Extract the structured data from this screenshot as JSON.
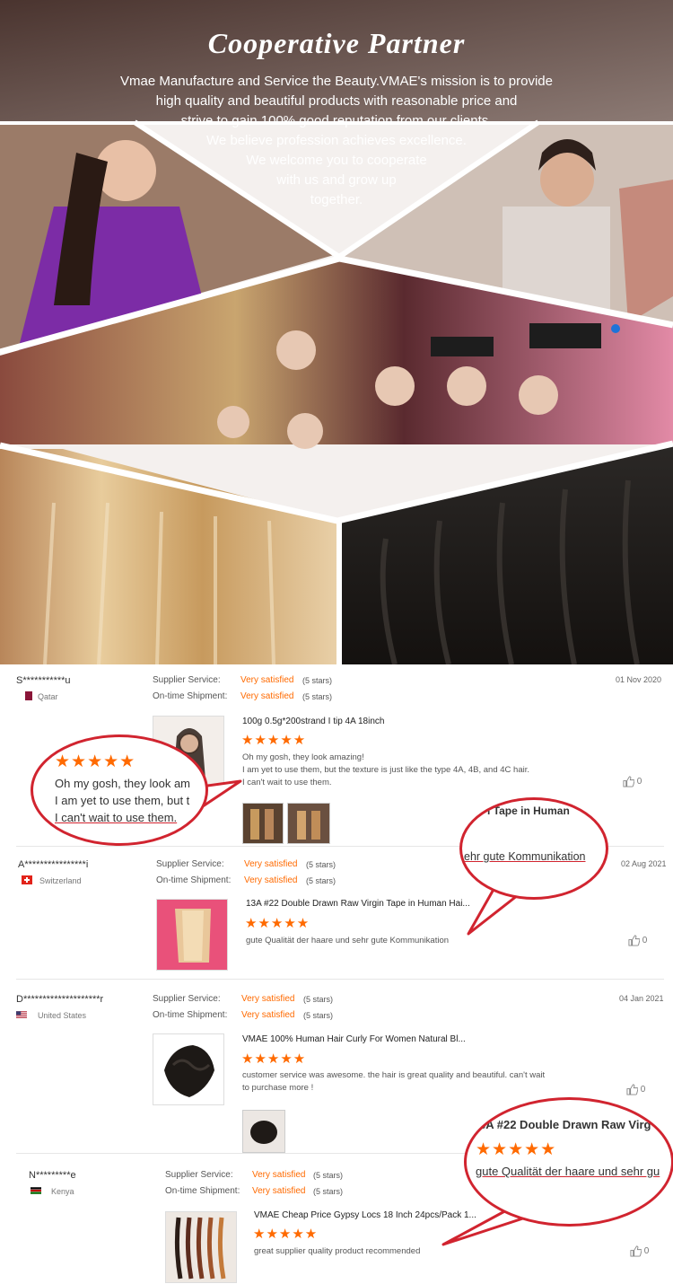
{
  "hero": {
    "title": "Cooperative Partner",
    "lines": [
      "Vmae Manufacture and Service the Beauty.VMAE's mission is to provide",
      "high quality and beautiful products with reasonable price and",
      "strive to gain 100% good reputation from our clients.",
      "We believe profession achieves excellence.",
      "We welcome you to cooperate",
      "with us and grow up",
      "together."
    ]
  },
  "labels": {
    "supplier_service": "Supplier Service:",
    "ontime_shipment": "On-time Shipment:",
    "stars_label": "(5 stars)",
    "star_glyphs": "★★★★★"
  },
  "reviews": [
    {
      "name": "S***********u",
      "country": "Qatar",
      "supplier_service": "Very satisfied",
      "ontime_shipment": "Very satisfied",
      "date": "01 Nov 2020",
      "product": "100g 0.5g*200strand I tip 4A 18inch",
      "rating": 5,
      "text": [
        "Oh my gosh, they look amazing!",
        "I am yet to use them, but the texture is just like the type 4A, 4B, and 4C hair.",
        "I can't wait to use them."
      ],
      "likes": "0"
    },
    {
      "name": "A****************i",
      "country": "Switzerland",
      "supplier_service": "Very satisfied",
      "ontime_shipment": "Very satisfied",
      "date": "02 Aug 2021",
      "product": "13A #22 Double Drawn Raw Virgin Tape in Human Hai...",
      "rating": 5,
      "text": [
        "gute Qualität der haare und sehr gute Kommunikation"
      ],
      "likes": "0"
    },
    {
      "name": "D********************r",
      "country": "United States",
      "supplier_service": "Very satisfied",
      "ontime_shipment": "Very satisfied",
      "date": "04 Jan 2021",
      "product": "VMAE 100% Human Hair Curly For Women Natural Bl...",
      "rating": 5,
      "text": [
        "customer service was awesome. the hair is great quality and beautiful. can't wait",
        "to purchase more !"
      ],
      "likes": "0"
    },
    {
      "name": "N*********e",
      "country": "Kenya",
      "supplier_service": "Very satisfied",
      "ontime_shipment": "Very satisfied",
      "date": "",
      "product": "VMAE Cheap Price Gypsy Locs 18 Inch 24pcs/Pack 1...",
      "rating": 5,
      "text": [
        "great supplier quality product recommended"
      ],
      "likes": "0"
    }
  ],
  "callouts": {
    "one": {
      "stars": "★★★★★",
      "lines": [
        "Oh my gosh, they look am",
        "I am yet to use them, but t",
        "I can't wait to use them."
      ]
    },
    "two": {
      "title": "l Tape in Human",
      "line": "ehr gute Kommunikation"
    },
    "three": {
      "title": "3A #22 Double Drawn Raw Virg",
      "stars": "★★★★★",
      "line": "gute Qualität der haare und sehr gu"
    }
  },
  "colors": {
    "accent": "#ff6a00",
    "callout": "#d1242f",
    "hero_bg": "#3a2a26"
  }
}
